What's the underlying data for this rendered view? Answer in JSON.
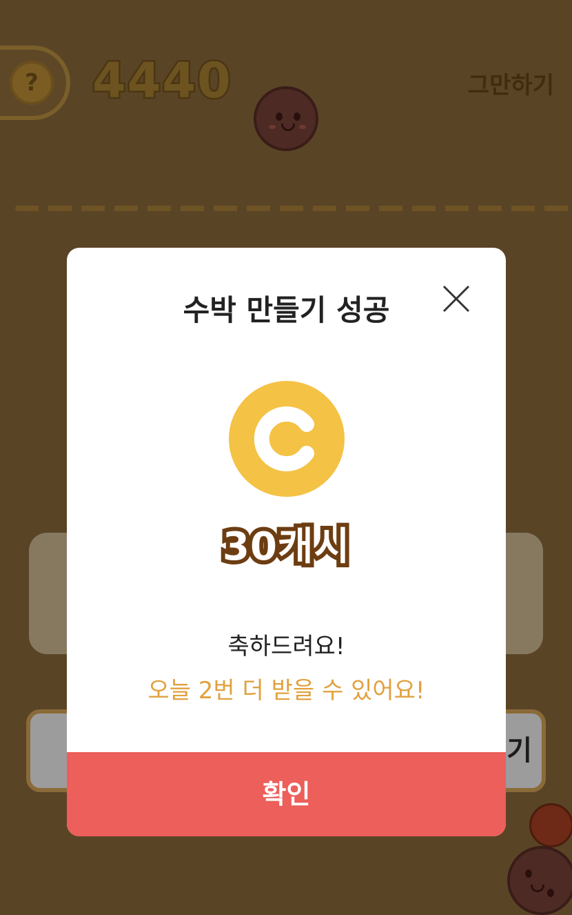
{
  "header": {
    "help_icon": "?",
    "score": "4440",
    "quit_label": "그만하기"
  },
  "background": {
    "right_button_fragment": "기"
  },
  "dialog": {
    "title": "수박 만들기 성공",
    "close_icon": "close-icon",
    "coin_letter": "C",
    "reward_label": "30캐시",
    "congrats": "축하드려요!",
    "remaining": "오늘 2번 더 받을 수 있어요!",
    "confirm_label": "확인"
  },
  "colors": {
    "dim_background": "#5a4426",
    "coin": "#f4c244",
    "reward_outline": "#6d3d12",
    "remaining_text": "#e1a13e",
    "confirm_button": "#ec5f5a"
  }
}
